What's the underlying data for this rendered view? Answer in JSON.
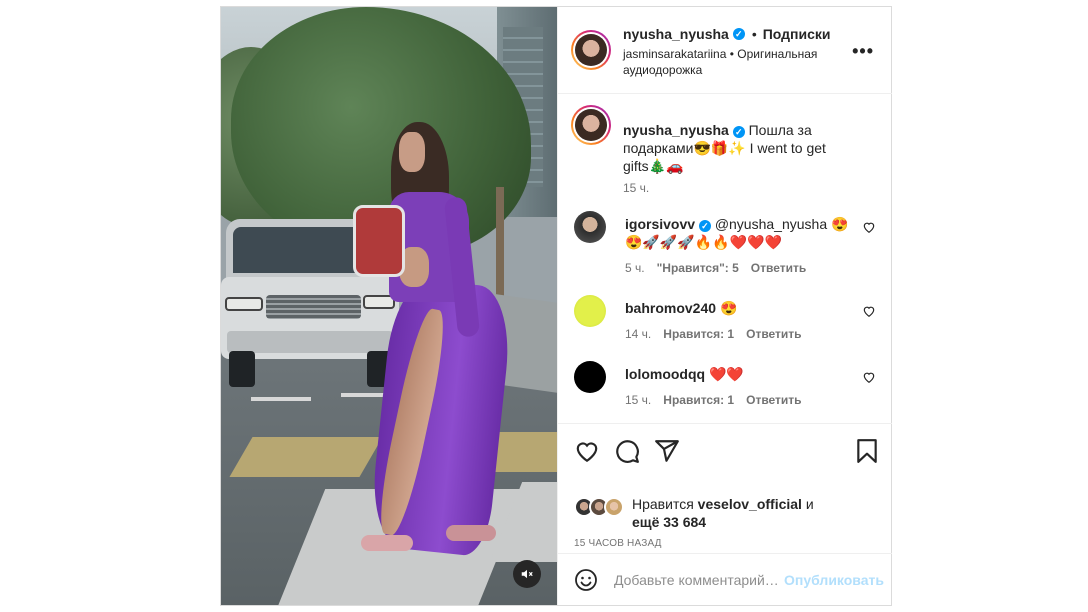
{
  "header": {
    "username": "nyusha_nyusha",
    "separator": "•",
    "follow_label": "Подписки",
    "audio": "jasminsarakatariina • Оригинальная аудиодорожка",
    "more_label": "•••"
  },
  "caption": {
    "username": "nyusha_nyusha",
    "text": "Пошла за подарками😎🎁✨ I went to get gifts🎄🚗",
    "time": "15 ч."
  },
  "comments": [
    {
      "username": "igorsivovv",
      "verified": true,
      "text": "@nyusha_nyusha 😍😍🚀🚀🚀🔥🔥❤️❤️❤️",
      "time": "5 ч.",
      "likes": "\"Нравится\": 5",
      "reply": "Ответить"
    },
    {
      "username": "bahromov240",
      "verified": false,
      "text": "😍",
      "time": "14 ч.",
      "likes": "Нравится: 1",
      "reply": "Ответить"
    },
    {
      "username": "lolomoodqq",
      "verified": false,
      "text": "❤️❤️",
      "time": "15 ч.",
      "likes": "Нравится: 1",
      "reply": "Ответить"
    }
  ],
  "actions": {
    "liked_by_prefix": "Нравится ",
    "liked_by_user": "veselov_official",
    "liked_by_mid": " и",
    "liked_by_others": "ещё 33 684",
    "time_ago": "15 ЧАСОВ НАЗАД"
  },
  "add_comment": {
    "placeholder": "Добавьте комментарий…",
    "publish_label": "Опубликовать"
  },
  "colors": {
    "accent": "#0095f6",
    "publish_disabled": "#b2dffc",
    "heart_red": "#ed4956"
  }
}
